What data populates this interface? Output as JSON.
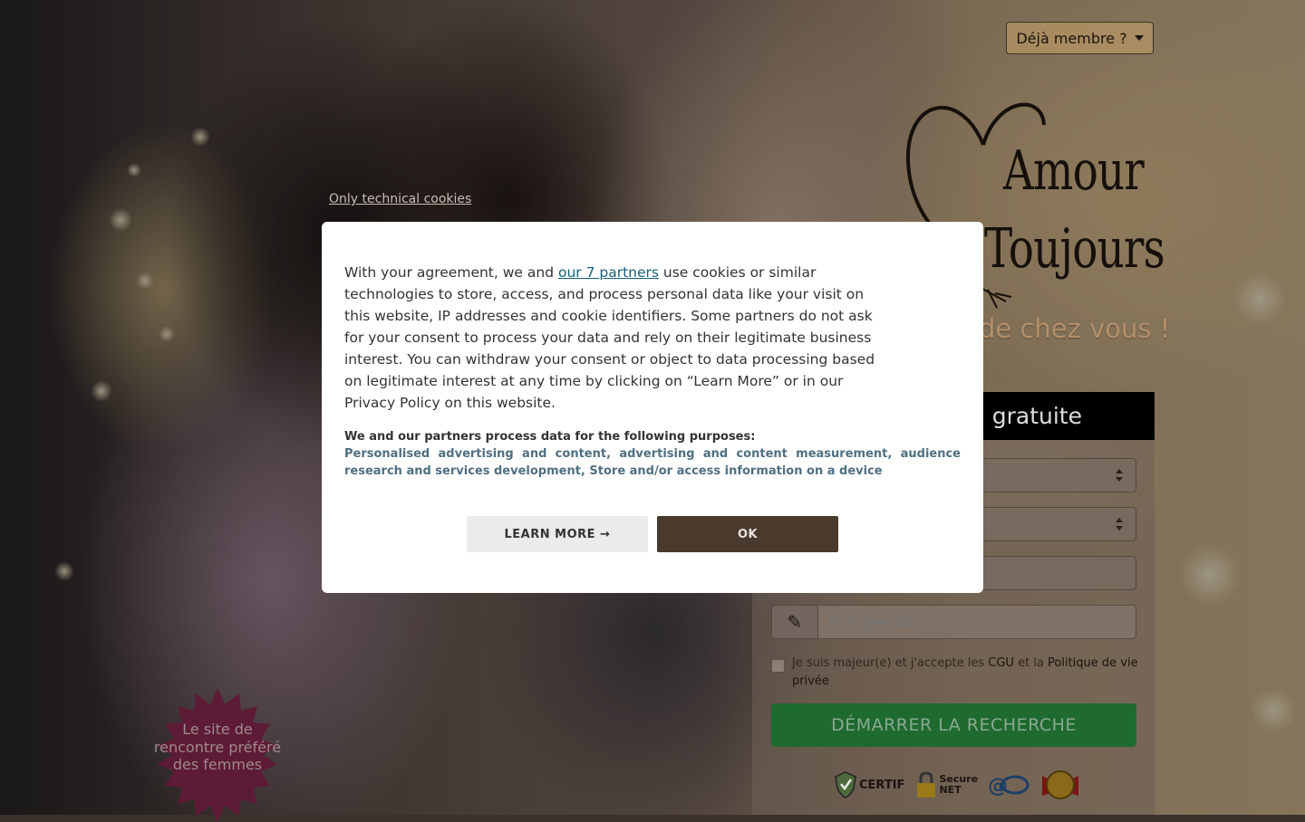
{
  "header": {
    "member_button": "Déjà membre ?"
  },
  "brand": {
    "line1": "Amour",
    "line2": "Toujours",
    "tagline": "de chez vous !"
  },
  "signup": {
    "heading": "gratuite",
    "pseudo_placeholder": "Mon pseudo",
    "consent_text_1": "Je suis majeur(e) et j'accepte les ",
    "cgu_link": "CGU",
    "consent_text_2": " et la ",
    "privacy_link": "Politique de vie privée",
    "submit": "DÉMARRER LA RECHERCHE",
    "badges": [
      "CERTIF",
      "Secure NET"
    ]
  },
  "promo": {
    "starburst": "Le site de rencontre préféré des femmes"
  },
  "cookie": {
    "tech_only": "Only technical cookies",
    "intro_before": "With your agreement, we and ",
    "partners_link": "our 7 partners",
    "intro_after": " use cookies or similar technologies to store, access, and process personal data like your visit on this website, IP addresses and cookie identifiers. Some partners do not ask for your consent to process your data and rely on their legitimate business interest. You can withdraw your consent or object to data processing based on legitimate interest at any time by clicking on “Learn More” or in our Privacy Policy on this website.",
    "purposes_title": "We and our partners process data for the following purposes:",
    "purposes_list": "Personalised advertising and content, advertising and content measurement, audience research and services development, Store and/or access information on a device",
    "learn_more": "LEARN MORE →",
    "ok": "OK"
  },
  "colors": {
    "cta": "#1e6a2f",
    "ok_button": "#4a3a2e",
    "starburst": "#6b1f3c",
    "link": "#17607d"
  }
}
